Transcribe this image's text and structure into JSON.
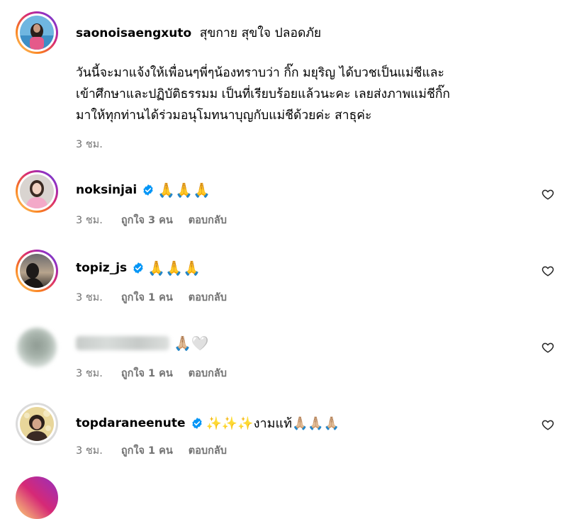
{
  "caption": {
    "username": "saonoisaengxuto",
    "title": "สุขกาย สุขใจ ปลอดภัย",
    "lines": [
      "วันนี้จะมาแจ้งให้เพื่อนๆพี่ๆน้องทราบว่า กิ๊ก มยุริญ ได้บวชเป็นแม่ชีและ",
      "เข้าศึกษาและปฏิบัติธรรมม เป็นที่เรียบร้อยแล้วนะคะ เลยส่งภาพแม่ชีกิ๊ก",
      "มาให้ทุกท่านได้ร่วมอนุโมทนาบุญกับแม่ชีด้วยค่ะ สาธุค่ะ"
    ],
    "time": "3 ชม."
  },
  "comments": [
    {
      "username": "noksinjai",
      "verified": true,
      "text": "🙏🙏🙏",
      "time": "3 ชม.",
      "likes": "ถูกใจ 3 คน",
      "reply": "ตอบกลับ"
    },
    {
      "username": "topiz_js",
      "verified": true,
      "text": "🙏🙏🙏",
      "time": "3 ชม.",
      "likes": "ถูกใจ 1 คน",
      "reply": "ตอบกลับ"
    },
    {
      "username": "",
      "verified": false,
      "text": "🙏🏼🤍",
      "time": "3 ชม.",
      "likes": "ถูกใจ 1 คน",
      "reply": "ตอบกลับ"
    },
    {
      "username": "topdaraneenute",
      "verified": true,
      "text": "✨✨✨งามแท้🙏🏼🙏🏼🙏🏼",
      "time": "3 ชม.",
      "likes": "ถูกใจ 1 คน",
      "reply": "ตอบกลับ"
    }
  ],
  "colors": {
    "verified": "#0095f6",
    "meta": "#737373"
  },
  "icons": {
    "like": "heart-outline-icon",
    "verified": "verified-badge-icon"
  }
}
